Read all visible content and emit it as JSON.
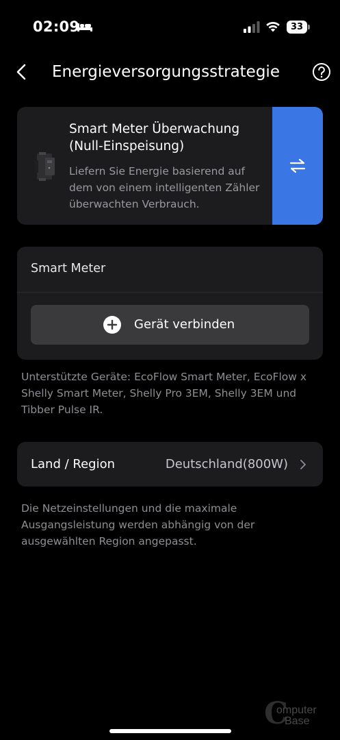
{
  "status_bar": {
    "time": "02:09",
    "battery": "33",
    "icons": [
      "bed-icon",
      "signal-icon",
      "wifi-icon",
      "battery-icon"
    ]
  },
  "nav": {
    "title": "Energieversorgungsstrategie",
    "back_icon": "chevron-left-icon",
    "help_icon": "help-circle-icon"
  },
  "strategy": {
    "title": "Smart Meter Überwachung (Null-Einspeisung)",
    "description": "Liefern Sie Energie basierend auf dem von einem intelligenten Zähler überwachten Verbrauch.",
    "switch_icon": "swap-arrows-icon",
    "accent_color": "#3b76e5"
  },
  "smart_meter": {
    "label": "Smart Meter",
    "connect_label": "Gerät verbinden",
    "connect_icon": "plus-circle-icon"
  },
  "supported_devices": "Unterstützte Geräte: EcoFlow Smart Meter, EcoFlow x Shelly Smart Meter, Shelly Pro 3EM, Shelly 3EM und Tibber Pulse IR.",
  "region": {
    "label": "Land / Region",
    "value": "Deutschland(800W)",
    "icon": "chevron-right-icon"
  },
  "region_note": "Die Netzeinstellungen und die maximale Ausgangsleistung werden abhängig von der ausgewählten Region angepasst.",
  "watermark": {
    "line1": "omputer",
    "line2": "Base"
  }
}
